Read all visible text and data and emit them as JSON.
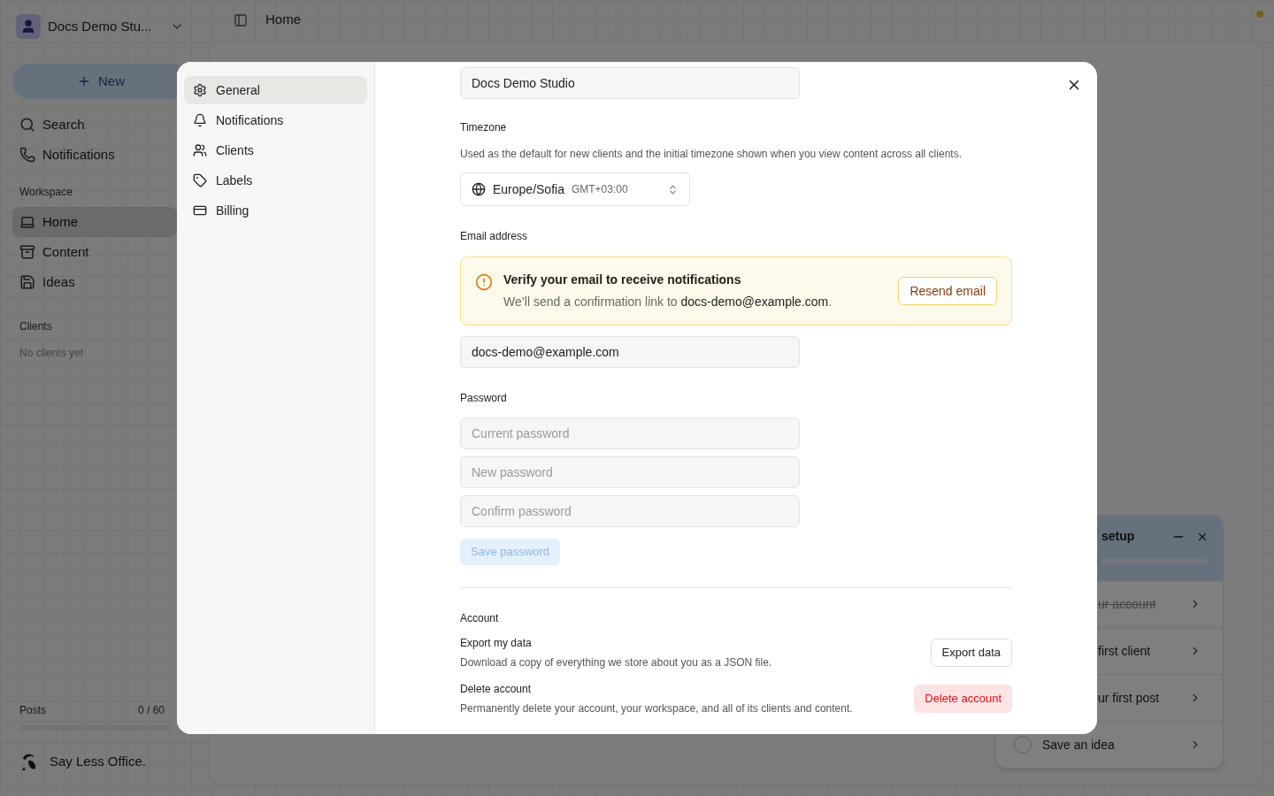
{
  "app": {
    "workspace_name": "Docs Demo Stu...",
    "breadcrumb": "Home",
    "new_button": "New",
    "nav": [
      {
        "label": "Search"
      },
      {
        "label": "Notifications"
      }
    ],
    "workspace_heading": "Workspace",
    "workspace_items": [
      {
        "label": "Home",
        "selected": true
      },
      {
        "label": "Content",
        "selected": false
      },
      {
        "label": "Ideas",
        "selected": false
      }
    ],
    "clients_heading": "Clients",
    "clients_empty": "No clients yet",
    "posts": {
      "label": "Posts",
      "count": "0 / 60",
      "level": 0
    },
    "brand": "Say Less Office.",
    "setup": {
      "title": "setup",
      "steps": [
        {
          "label": "ur account",
          "done": true,
          "kind": "covered"
        },
        {
          "label": "first client",
          "done": false,
          "kind": "covered"
        },
        {
          "label": "ur first post",
          "done": false,
          "kind": "covered"
        },
        {
          "label": "Save an idea",
          "done": false,
          "kind": "open"
        }
      ]
    }
  },
  "settings": {
    "nav": [
      {
        "label": "General",
        "selected": true
      },
      {
        "label": "Notifications",
        "selected": false
      },
      {
        "label": "Clients",
        "selected": false
      },
      {
        "label": "Labels",
        "selected": false
      },
      {
        "label": "Billing",
        "selected": false
      }
    ],
    "workspace_field": {
      "value": "Docs Demo Studio"
    },
    "timezone": {
      "label": "Timezone",
      "description": "Used as the default for new clients and the initial timezone shown when you view content across all clients.",
      "value": "Europe/Sofia",
      "offset": "GMT+03:00"
    },
    "email": {
      "label": "Email address",
      "alert_title": "Verify your email to receive notifications",
      "alert_text": "We’ll send a confirmation link to **docs-demo@example.com**.",
      "resend_button": "Resend email",
      "value": "docs-demo@example.com"
    },
    "password": {
      "label": "Password",
      "fields": [
        {
          "placeholder": "Current password"
        },
        {
          "placeholder": "New password"
        },
        {
          "placeholder": "Confirm password"
        }
      ],
      "save_button": "Save password",
      "save_disabled": true
    },
    "account": {
      "heading": "Account",
      "rows": [
        {
          "title": "Export my data",
          "description": "Download a copy of everything we store about you as a JSON file.",
          "button": "Export data",
          "kind": "neutral"
        },
        {
          "title": "Delete account",
          "description": "Permanently delete your account, your workspace, and all of its clients and content.",
          "button": "Delete account",
          "kind": "danger"
        }
      ]
    }
  }
}
